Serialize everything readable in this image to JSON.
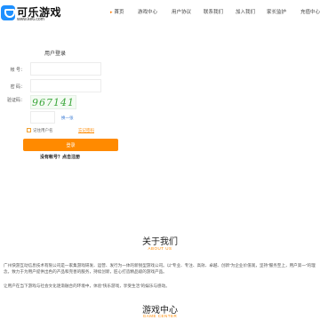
{
  "header": {
    "logo_title": "可乐游戏",
    "logo_url": "www.ke6.com",
    "nav": [
      {
        "label": "首页",
        "active": true
      },
      {
        "label": "游戏中心"
      },
      {
        "label": "用户协议"
      },
      {
        "label": "联系我们"
      },
      {
        "label": "加入我们"
      },
      {
        "label": "家长监护"
      },
      {
        "label": "充值中心"
      }
    ]
  },
  "login": {
    "title": "用户登录",
    "account_label": "帐 号：",
    "account_value": "",
    "password_label": "密 码：",
    "password_value": "",
    "captcha_label": "验证码：",
    "captcha_text": "967141",
    "captcha_value": "",
    "refresh_label": "换一张",
    "remember_label": "记住用户名",
    "forgot_label": "忘记密码",
    "submit_label": "登录",
    "register_text": "没有帐号？点击注册"
  },
  "about": {
    "title": "关于我们",
    "subtitle": "ABOUT US",
    "para1": "广州快游互动信息技术有限公司是一家集游戏研发、运营、发行为一体的新锐型游戏公司。以“专业、专注、高效、卓越、创新”为企业价值观，坚持“服务至上，用户第一”的理念，致力于为用户提供出色的产品和完善的服务，持续创新，匠心打造精品级的游戏产品。",
    "para2": "让用户在当下游戏与社会文化逐渐融合的环境中，体验“快乐游戏，享受生活”的娱乐与感动。"
  },
  "game_center": {
    "title": "游戏中心",
    "subtitle": "GAME CENTER"
  }
}
